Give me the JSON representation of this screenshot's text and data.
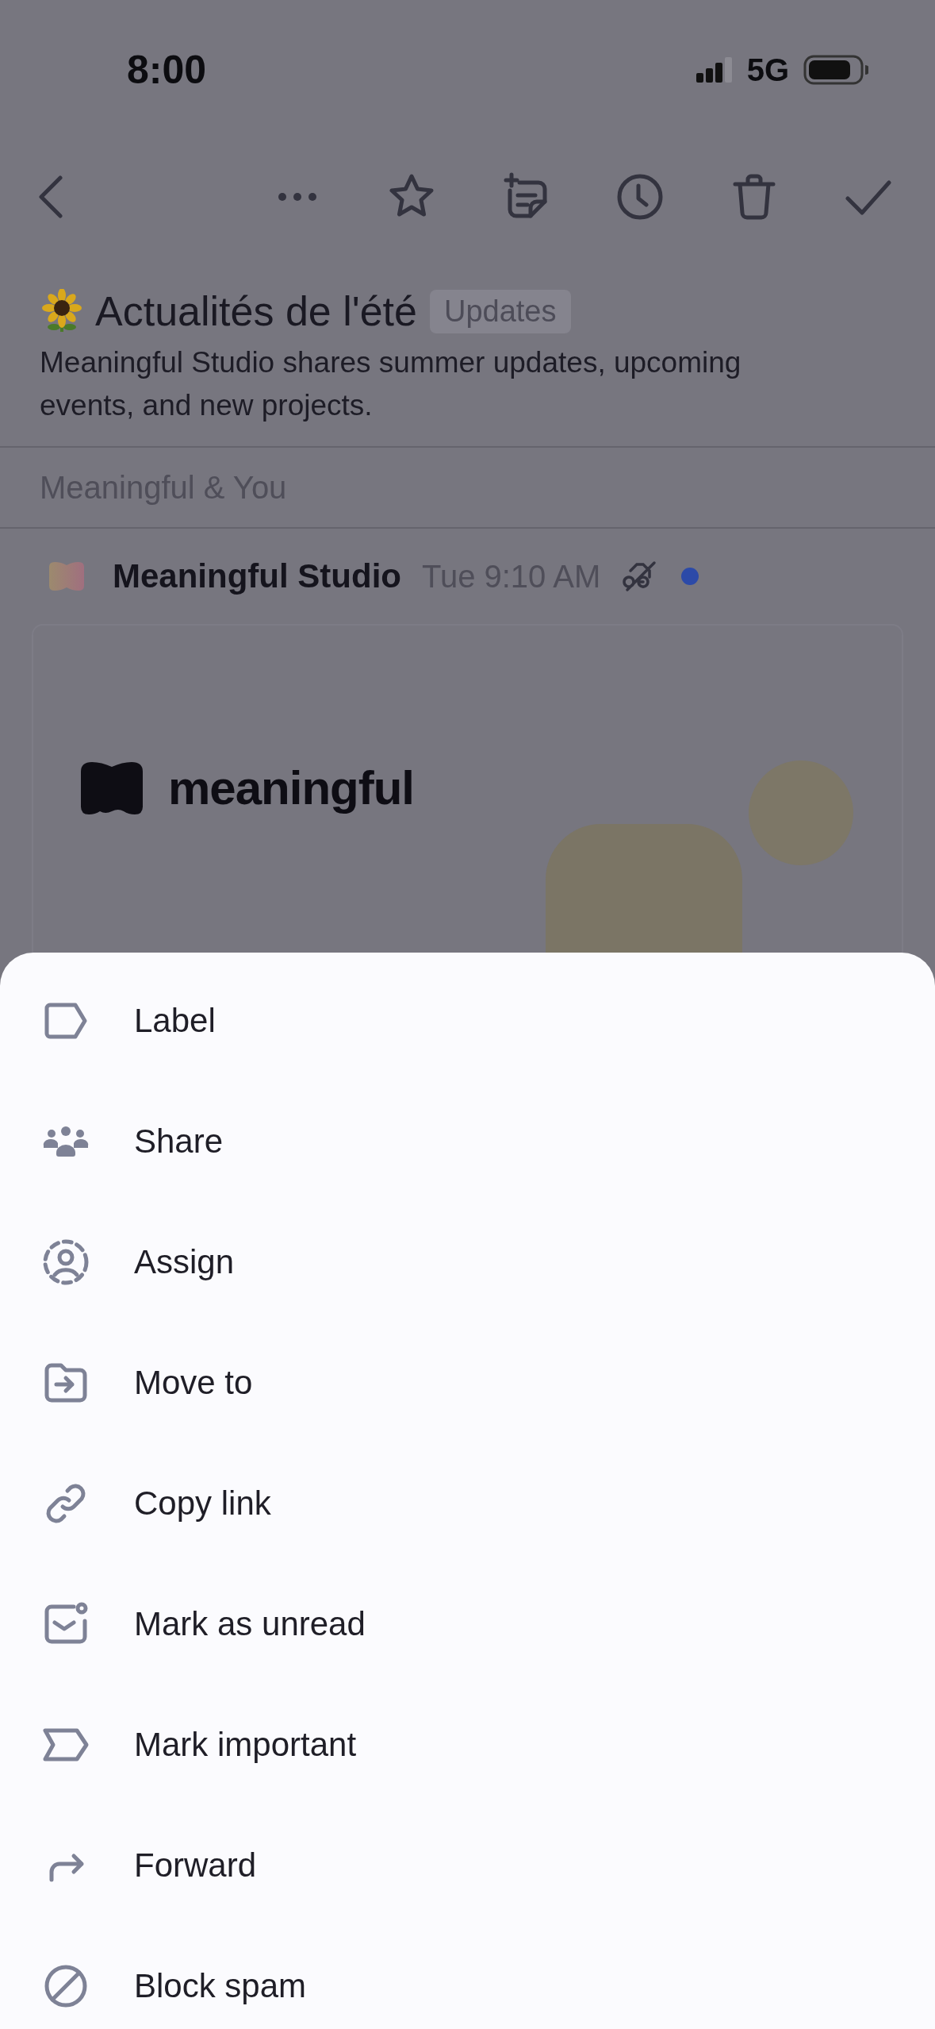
{
  "status_bar": {
    "time": "8:00",
    "network": "5G"
  },
  "thread": {
    "title": "Actualités de l'été",
    "tag": "Updates",
    "summary": "Meaningful Studio shares summer updates, upcoming events, and new projects.",
    "participants": "Meaningful & You"
  },
  "message": {
    "sender": "Meaningful Studio",
    "time": "Tue 9:10 AM",
    "unread": true,
    "logo_text": "meaningful"
  },
  "menu": [
    {
      "kind": "label",
      "label": "Label"
    },
    {
      "kind": "share",
      "label": "Share"
    },
    {
      "kind": "assign",
      "label": "Assign"
    },
    {
      "kind": "move",
      "label": "Move to"
    },
    {
      "kind": "link",
      "label": "Copy link"
    },
    {
      "kind": "unread",
      "label": "Mark as unread"
    },
    {
      "kind": "important",
      "label": "Mark important"
    },
    {
      "kind": "forward",
      "label": "Forward"
    },
    {
      "kind": "block",
      "label": "Block spam"
    }
  ]
}
